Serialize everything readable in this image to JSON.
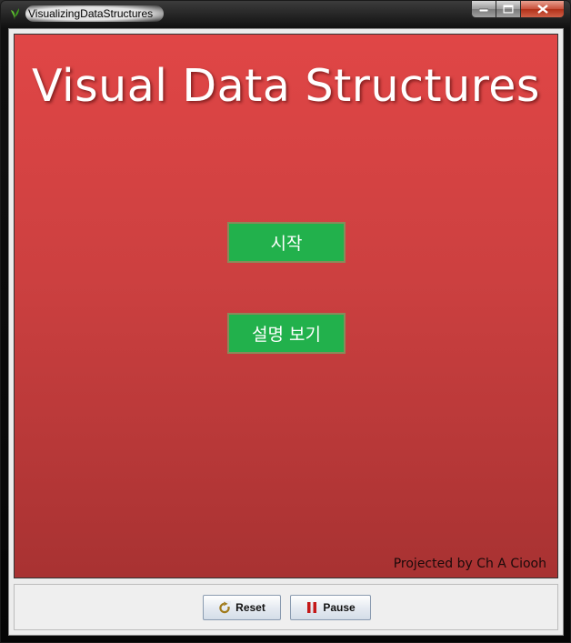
{
  "window": {
    "title": "VisualizingDataStructures",
    "icons": {
      "app": "app-leaf-icon",
      "minimize": "minimize-icon",
      "maximize": "maximize-icon",
      "close": "close-icon"
    }
  },
  "canvas": {
    "title": "Visual Data Structures",
    "start_label": "시작",
    "help_label": "설명 보기",
    "credit": "Projected by Ch A Ciooh",
    "colors": {
      "background_top": "#e04646",
      "background_bottom": "#a83232",
      "button": "#22b14c"
    }
  },
  "controls": {
    "reset_label": "Reset",
    "pause_label": "Pause",
    "icons": {
      "reset": "refresh-icon",
      "pause": "pause-icon"
    }
  }
}
